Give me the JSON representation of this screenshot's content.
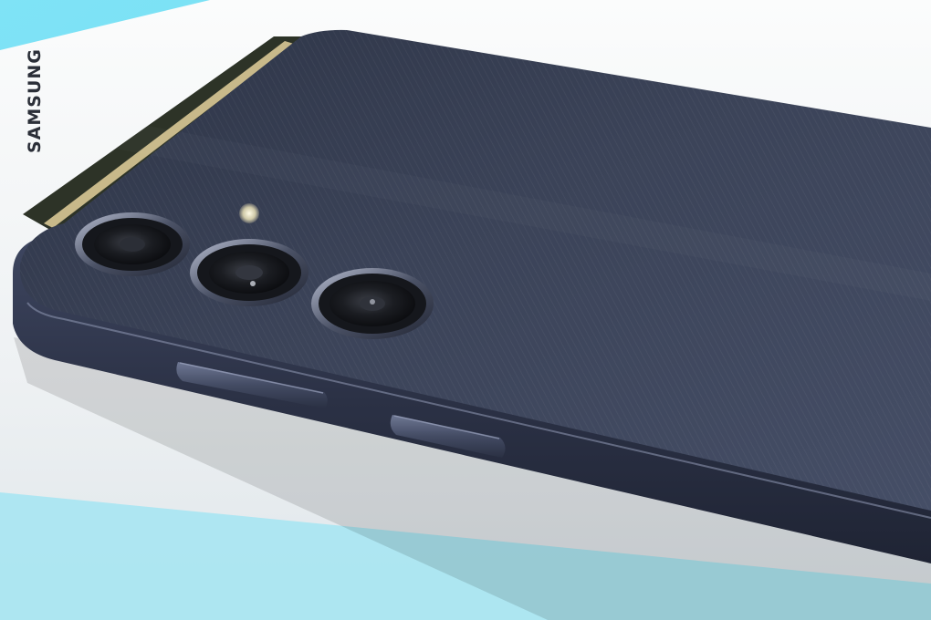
{
  "scene": {
    "subject": "phone-rear-camera-closeup",
    "background_color": "#7fe1f4",
    "box_color": "#f4f6f7",
    "phone_body_color": "#3a4256",
    "frame_color": "#2c3346",
    "accent_strip_color": "#c8b98a",
    "box_brand_text": "SAMSUNG"
  },
  "phone": {
    "camera_count": 3,
    "has_flash": true,
    "side_buttons": [
      "volume-rocker",
      "power-key"
    ]
  }
}
